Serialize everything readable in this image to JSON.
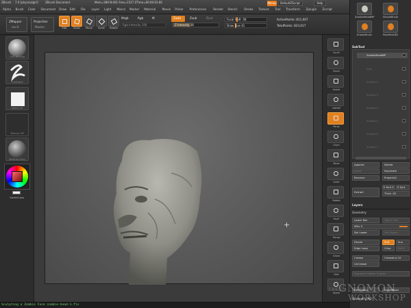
{
  "app": {
    "title_left": "ZBrush",
    "title_ver": "7.0 [physicalgirl]",
    "title_doc": "ZBrush Document",
    "title_mem": "Mem=389 N:401  Free=1527  ZTime=00:00:03.66",
    "menus_label": "Menus",
    "script_label": "DefaultZScript",
    "help_label": "Help"
  },
  "menus": [
    "Alpha",
    "Brush",
    "Color",
    "Document",
    "Draw",
    "Edit",
    "File",
    "Layer",
    "Light",
    "Macro",
    "Marker",
    "Material",
    "Movie",
    "Picker",
    "Preferences",
    "Render",
    "Stencil",
    "Stroke",
    "Texture",
    "Tool",
    "Transform",
    "Zplugin",
    "Zscript"
  ],
  "toolbar": {
    "zmapper_label": "ZMapper",
    "zmapper_sub": "rev-E",
    "projection_label": "Projection",
    "projection_sub": "Master",
    "tools": [
      {
        "label": "Edit",
        "icon": "edit-icon",
        "active": true
      },
      {
        "label": "Draw",
        "icon": "draw-icon",
        "active": true
      },
      {
        "label": "Move",
        "icon": "move-icon",
        "active": false
      },
      {
        "label": "Scale",
        "icon": "scale-icon",
        "active": false
      },
      {
        "label": "Rotate",
        "icon": "rotate-icon",
        "active": false
      }
    ],
    "mrgb": "Mrgb",
    "rgb": "Rgb",
    "m": "M",
    "rgb_intensity": "Rgb Intensity 100",
    "zadd": "Zadd",
    "zsub": "Zsub",
    "zcut": "Zcut",
    "z_intensity": "Z Intensity 38",
    "focal_shift": "Focal Shift -58",
    "draw_size": "Draw Size 41",
    "active_points": "ActivePoints: 811,007",
    "total_points": "TotalPoints: 823,017"
  },
  "left_shelf": {
    "brush_label": "Clay Buildup",
    "stroke_label": "FreeHand",
    "alpha_label": "Alpha Off",
    "texture_label": "Texture Off",
    "material_label": "MatCap Gray",
    "switch_color_label": "SwitchColor"
  },
  "right_shelf": [
    {
      "label": "Scroll",
      "icon": "scroll-icon",
      "orange": false
    },
    {
      "label": "Zoom",
      "icon": "zoom-icon",
      "orange": false
    },
    {
      "label": "Actual",
      "icon": "actual-icon",
      "orange": false
    },
    {
      "label": "AAHalf",
      "icon": "aahalf-icon",
      "orange": false
    },
    {
      "label": "Persp",
      "icon": "persp-icon",
      "orange": true
    },
    {
      "label": "LSym",
      "icon": "lsym-icon",
      "orange": false
    },
    {
      "label": "Move",
      "icon": "move-icon",
      "orange": false
    },
    {
      "label": "Scale",
      "icon": "scale-icon",
      "orange": false
    },
    {
      "label": "Rotate",
      "icon": "rotate-icon",
      "orange": false
    },
    {
      "label": "PolyF",
      "icon": "polyf-icon",
      "orange": false
    },
    {
      "label": "Transp",
      "icon": "transp-icon",
      "orange": false
    },
    {
      "label": "Ghost",
      "icon": "ghost-icon",
      "orange": false
    },
    {
      "label": "Solo",
      "icon": "solo-icon",
      "orange": false
    },
    {
      "label": "Xpose",
      "icon": "xpose-icon",
      "orange": false
    }
  ],
  "tray": {
    "top_tools": [
      {
        "label": "ZombieHeadMP"
      },
      {
        "label": "SimpleBrush"
      },
      {
        "label": "EraserBrush"
      },
      {
        "label": "PolyMesh3D"
      }
    ],
    "subtool_header": "SubTool",
    "subtools": [
      {
        "label": "ZombieHeadMP",
        "selected": true
      },
      {
        "label": "eyes",
        "selected": false
      },
      {
        "label": "Subtool 2",
        "selected": false
      },
      {
        "label": "Subtool 3",
        "selected": false
      },
      {
        "label": "Subtool 4",
        "selected": false
      },
      {
        "label": "Subtool 5",
        "selected": false
      },
      {
        "label": "Subtool 6",
        "selected": false
      },
      {
        "label": "Subtool 7",
        "selected": false
      }
    ],
    "buttons": {
      "append": "Append",
      "delete": "Delete",
      "insert": "Insert",
      "duplicate": "Duplicate",
      "rename": "Rename",
      "project_all": "ProjectAll",
      "extract": "Extract",
      "e_smt": "E Smt 5",
      "s_smt": "S Smt",
      "thick": "Thick .02"
    },
    "layers_header": "Layers",
    "geometry_header": "Geometry",
    "geometry": {
      "lower_res": "Lower Res",
      "higher_res": "Higher Res",
      "sdiv": "SDiv 5",
      "del_lower": "Del Lower",
      "del_higher": "Del Higher",
      "divide": "Divide",
      "smt": "Smt",
      "suv": "Suv",
      "edge_loop": "Edge Loop",
      "crisp": "Crisp",
      "reuv": "ReUV",
      "crease": "Crease",
      "crease_lvl": "CreaseLvl 15",
      "uncrease": "UnCrease",
      "reproject": "Reproject Higher Subdiv",
      "del_hidden": "DelHidden",
      "insert_mesh": "InsertMesh",
      "geometry_hd": "Geometry HD"
    }
  },
  "status": {
    "text": "Sculpting a Zombie Face  zombie-head-1.flv"
  },
  "watermark": {
    "line1": "THE",
    "line2": "GNOMON",
    "line3": "WORKSHOP"
  },
  "colors": {
    "accent": "#e08020",
    "status_text": "#6bd06b"
  }
}
